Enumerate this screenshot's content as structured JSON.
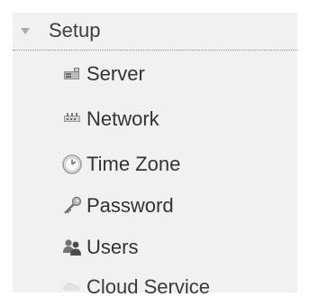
{
  "section": {
    "title": "Setup",
    "expanded": true,
    "toggle_icon": "caret-down-icon"
  },
  "items": [
    {
      "label": "Server",
      "icon": "server-icon"
    },
    {
      "label": "Network",
      "icon": "network-icon"
    },
    {
      "label": "Time Zone",
      "icon": "clock-icon"
    },
    {
      "label": "Password",
      "icon": "key-icon"
    },
    {
      "label": "Users",
      "icon": "users-icon"
    },
    {
      "label": "Cloud Service",
      "icon": "cloud-icon"
    }
  ],
  "colors": {
    "panel_background": "#f1f1f1",
    "text": "#333333",
    "caret": "#a9a9a9"
  }
}
